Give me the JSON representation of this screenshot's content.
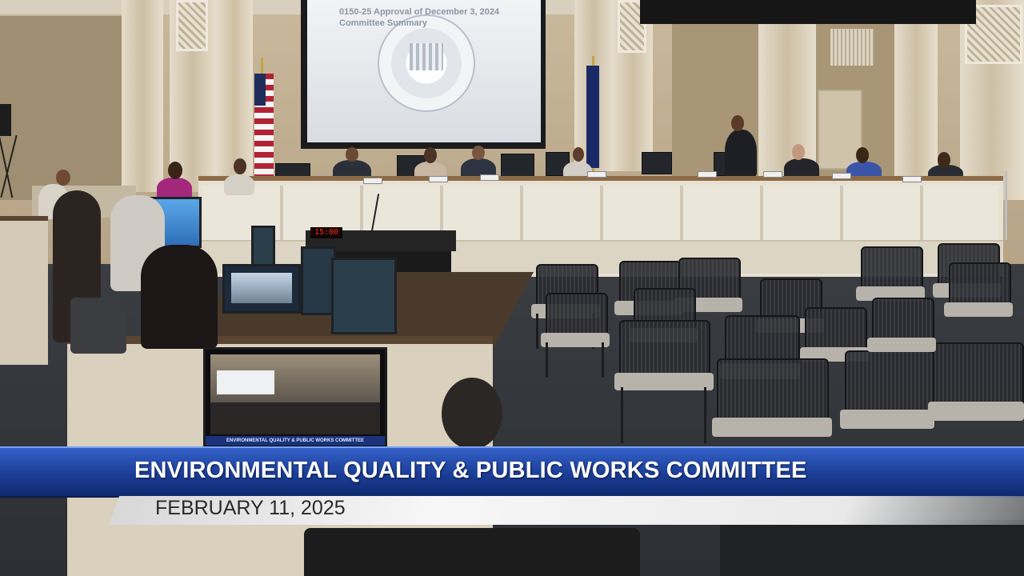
{
  "lower_third": {
    "title": "ENVIRONMENTAL QUALITY & PUBLIC WORKS COMMITTEE",
    "date": "FEBRUARY 11, 2025"
  },
  "projection_screen": {
    "line1": "0150-25 Approval of December 3, 2024",
    "line2": "Committee Summary"
  },
  "podium_timer": "15:00",
  "preview_monitor": {
    "caption": "ENVIRONMENTAL QUALITY & PUBLIC WORKS COMMITTEE"
  },
  "colors": {
    "banner_blue": "#1b3d96",
    "date_bar": "#f0f0f0",
    "timer_red": "#ff2a1a"
  }
}
